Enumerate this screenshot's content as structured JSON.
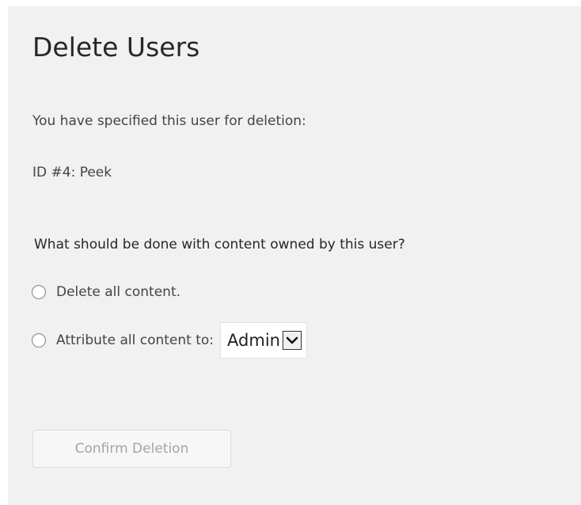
{
  "page": {
    "title": "Delete Users",
    "intro": "You have specified this user for deletion:",
    "user_line": "ID #4: Peek",
    "question": "What should be done with content owned by this user?"
  },
  "options": [
    {
      "label": "Delete all content.",
      "selected": false
    },
    {
      "label": "Attribute all content to:",
      "selected": false
    }
  ],
  "attribute_select": {
    "value": "Admin",
    "icon": "chevron-down-icon"
  },
  "confirm_button": {
    "label": "Confirm Deletion",
    "enabled": false
  }
}
